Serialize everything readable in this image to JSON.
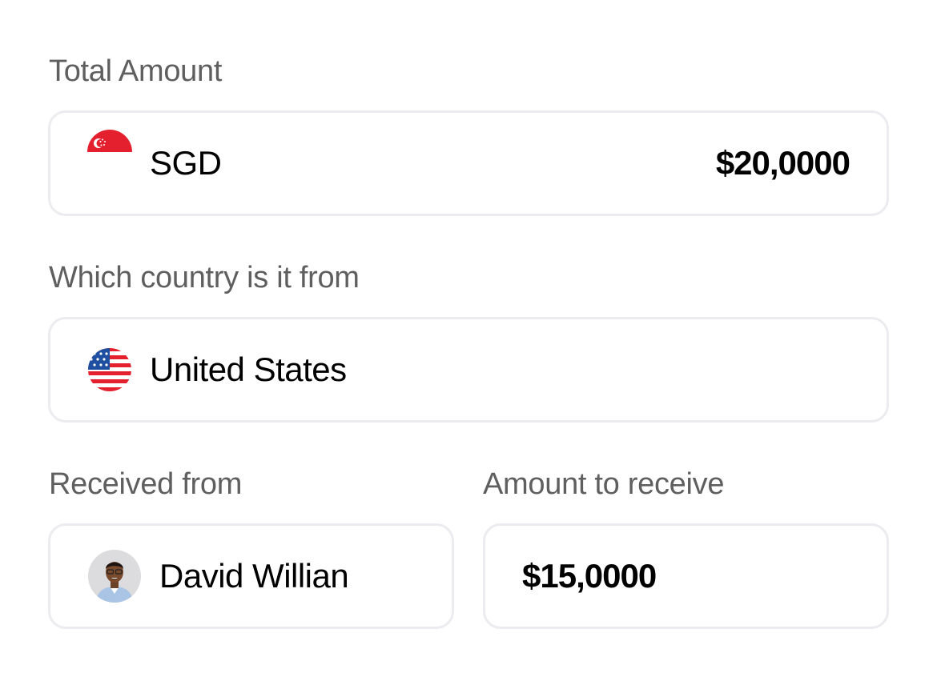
{
  "total_amount": {
    "label": "Total Amount",
    "currency": "SGD",
    "value": "$20,0000",
    "flag_icon": "singapore-flag-icon"
  },
  "country": {
    "label": "Which country is it from",
    "value": "United States",
    "flag_icon": "us-flag-icon"
  },
  "received_from": {
    "label": "Received from",
    "name": "David Willian",
    "avatar_icon": "avatar"
  },
  "amount_to_receive": {
    "label": "Amount to receive",
    "value": "$15,0000"
  },
  "colors": {
    "label": "#5f5f5f",
    "border": "#ebebf0",
    "flag_red": "#e4202f",
    "flag_blue": "#1f4fa0"
  }
}
